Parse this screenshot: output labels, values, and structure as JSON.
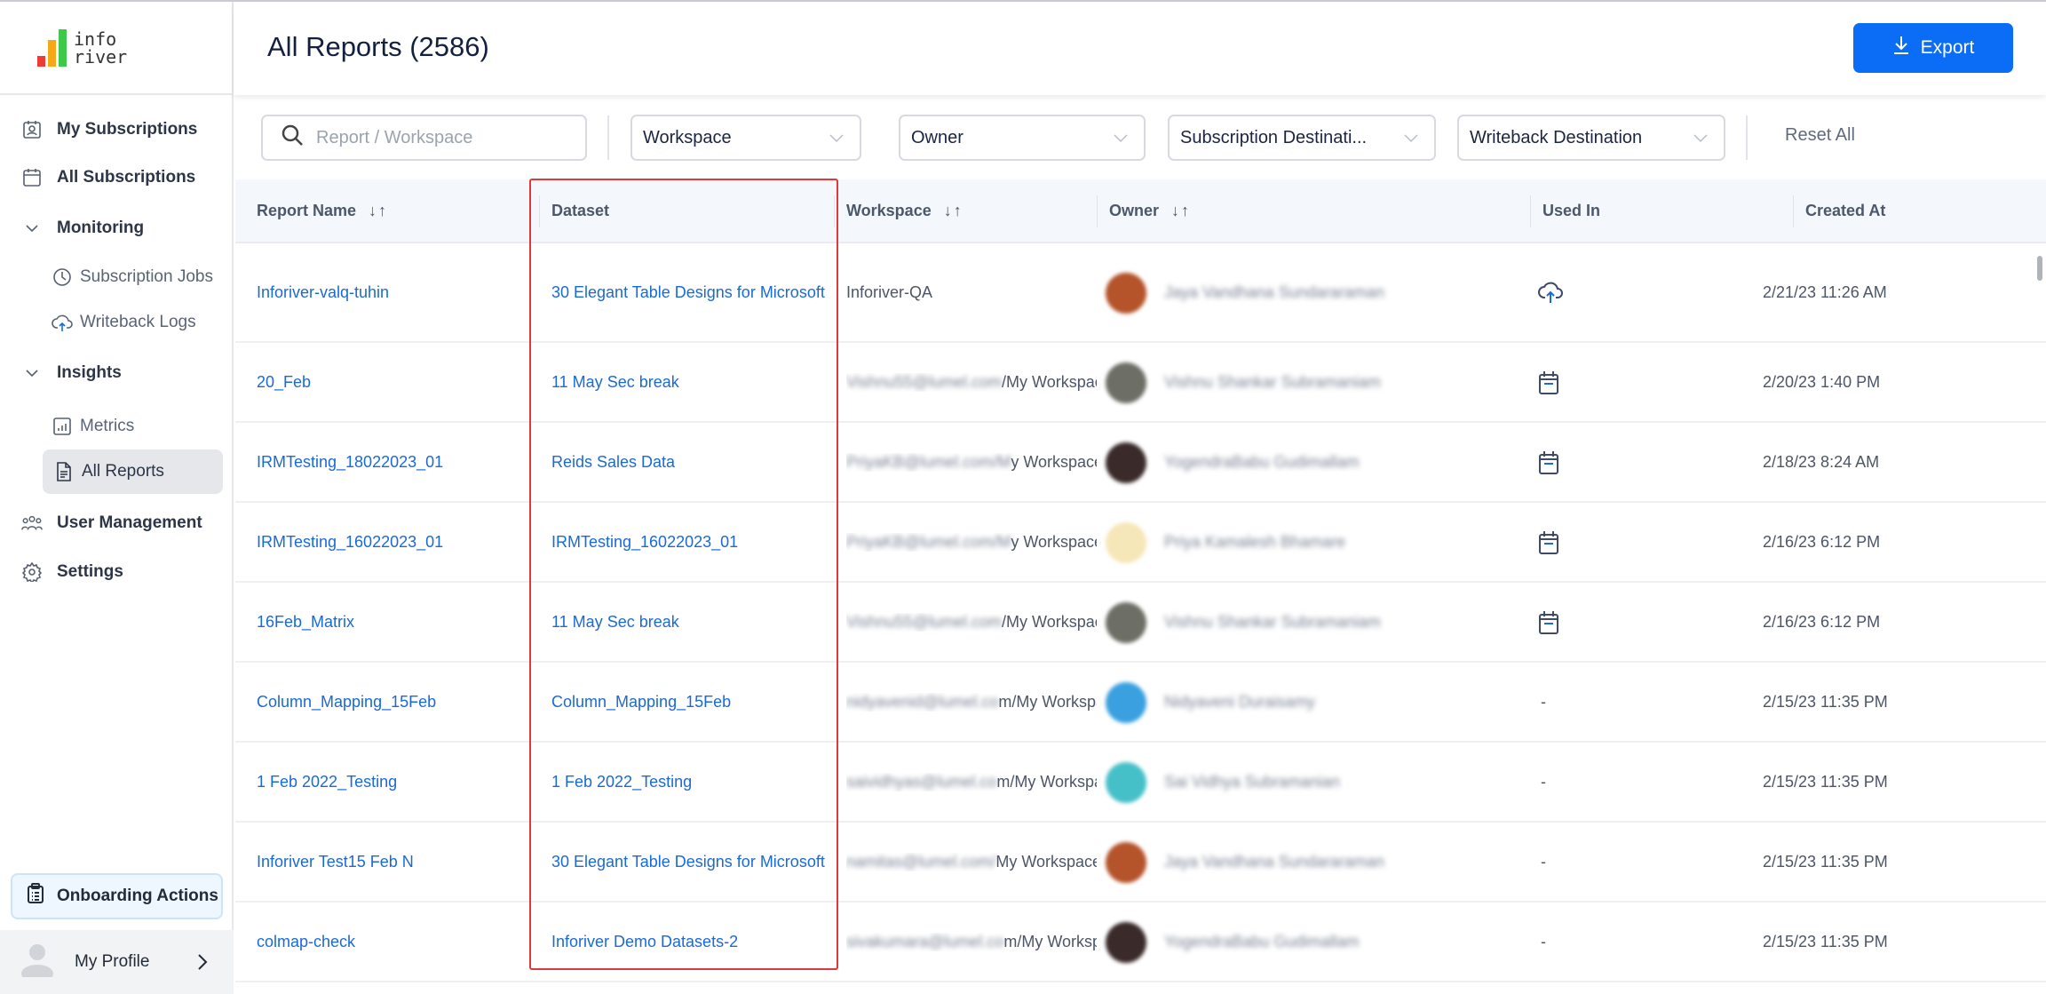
{
  "logo": {
    "line1": "info",
    "line2": "river"
  },
  "sidebar": {
    "items": [
      {
        "label": "My Subscriptions",
        "icon": "subscription-badge-icon"
      },
      {
        "label": "All Subscriptions",
        "icon": "calendar-icon"
      },
      {
        "label": "Monitoring",
        "icon": "chevron-down-icon"
      },
      {
        "label": "Subscription Jobs",
        "icon": "clock-icon"
      },
      {
        "label": "Writeback Logs",
        "icon": "cloud-upload-icon"
      },
      {
        "label": "Insights",
        "icon": "chevron-down-icon"
      },
      {
        "label": "Metrics",
        "icon": "bar-chart-icon"
      },
      {
        "label": "All Reports",
        "icon": "document-icon",
        "active": true
      },
      {
        "label": "User Management",
        "icon": "users-icon"
      },
      {
        "label": "Settings",
        "icon": "gear-icon"
      }
    ],
    "onboarding": "Onboarding Actions",
    "profile": "My Profile"
  },
  "header": {
    "title": "All Reports (2586)",
    "export": "Export",
    "accent": "#0b6cf5"
  },
  "filters": {
    "search_placeholder": "Report / Workspace",
    "workspace": "Workspace",
    "owner": "Owner",
    "subscription_destination": "Subscription Destinati...",
    "writeback_destination": "Writeback Destination",
    "reset": "Reset All"
  },
  "table": {
    "columns": [
      "Report Name",
      "Dataset",
      "Workspace",
      "Owner",
      "Used In",
      "Created At"
    ],
    "rows": [
      {
        "report": "Inforiver-valq-tuhin",
        "dataset": "30 Elegant Table Designs for Microsoft",
        "ws_email": "",
        "ws_suffix": "Inforiver-QA",
        "owner": "Jaya Vandhana Sundararaman",
        "avatar": "#b5532a",
        "used": "cloud-upload-icon",
        "created": "2/21/23 11:26 AM"
      },
      {
        "report": "20_Feb",
        "dataset": "11 May Sec break",
        "ws_email": "Vishnu55@lumel.com",
        "ws_suffix": "/My Workspace",
        "owner": "Vishnu Shankar Subramaniam",
        "avatar": "#6d6f66",
        "used": "calendar-icon",
        "created": "2/20/23 1:40 PM"
      },
      {
        "report": "IRMTesting_18022023_01",
        "dataset": "Reids Sales Data",
        "ws_email": "PriyaKB@lumel.com/M",
        "ws_suffix": "y Workspace",
        "owner": "YogendraBabu Gudimallam",
        "avatar": "#3a2a2a",
        "used": "calendar-icon",
        "created": "2/18/23 8:24 AM"
      },
      {
        "report": "IRMTesting_16022023_01",
        "dataset": "IRMTesting_16022023_01",
        "ws_email": "PriyaKB@lumel.com/M",
        "ws_suffix": "y Workspace",
        "owner": "Priya Kamalesh Bhamare",
        "avatar": "#f6e7b8",
        "used": "calendar-icon",
        "created": "2/16/23 6:12 PM"
      },
      {
        "report": "16Feb_Matrix",
        "dataset": "11 May Sec break",
        "ws_email": "Vishnu55@lumel.com",
        "ws_suffix": "/My Workspace",
        "owner": "Vishnu Shankar Subramaniam",
        "avatar": "#6d6f66",
        "used": "calendar-icon",
        "created": "2/16/23 6:12 PM"
      },
      {
        "report": "Column_Mapping_15Feb",
        "dataset": "Column_Mapping_15Feb",
        "ws_email": "nidyavenid@lumel.co",
        "ws_suffix": "m/My Workspace",
        "owner": "Nidyaveni Duraisamy",
        "avatar": "#3aa0e0",
        "used": "-",
        "created": "2/15/23 11:35 PM"
      },
      {
        "report": "1 Feb 2022_Testing",
        "dataset": "1 Feb 2022_Testing",
        "ws_email": "saividhyas@lumel.co",
        "ws_suffix": "m/My Workspace",
        "owner": "Sai Vidhya Subramanian",
        "avatar": "#46c0c8",
        "used": "-",
        "created": "2/15/23 11:35 PM"
      },
      {
        "report": "Inforiver Test15 Feb N",
        "dataset": "30 Elegant Table Designs for Microsoft",
        "ws_email": "namitas@lumel.com/",
        "ws_suffix": "My Workspace",
        "owner": "Jaya Vandhana Sundararaman",
        "avatar": "#b5532a",
        "used": "-",
        "created": "2/15/23 11:35 PM"
      },
      {
        "report": "colmap-check",
        "dataset": "Inforiver Demo Datasets-2",
        "ws_email": "sivakumara@lumel.co",
        "ws_suffix": "m/My Workspace",
        "owner": "YogendraBabu Gudimallam",
        "avatar": "#3a2a2a",
        "used": "-",
        "created": "2/15/23 11:35 PM"
      }
    ]
  }
}
